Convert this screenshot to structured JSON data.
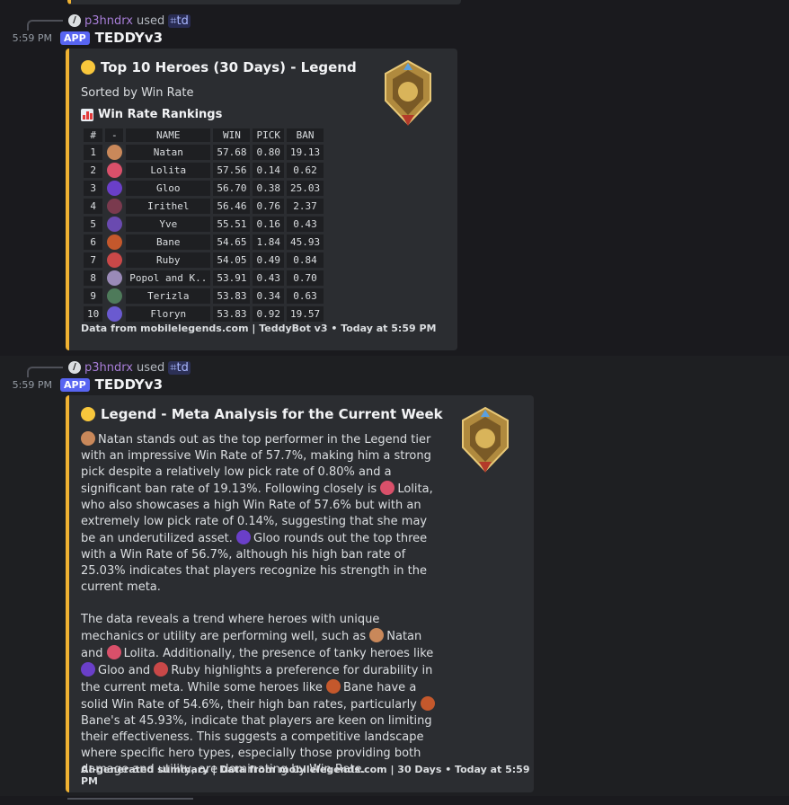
{
  "top_embed_edge": "",
  "messages": [
    {
      "reply": {
        "user": "p3hndrx",
        "used": "used",
        "command": "td"
      },
      "time": "5:59 PM",
      "badge": "APP",
      "bot": "TEDDYv3",
      "embed": {
        "title": "Top 10 Heroes (30 Days) - Legend",
        "subtitle": "Sorted by Win Rate",
        "section": "Win Rate Rankings",
        "table": {
          "headers": [
            "#",
            "-",
            "NAME",
            "WIN",
            "PICK",
            "BAN"
          ],
          "rows": [
            [
              "1",
              "Natan",
              "57.68",
              "0.80",
              "19.13"
            ],
            [
              "2",
              "Lolita",
              "57.56",
              "0.14",
              "0.62"
            ],
            [
              "3",
              "Gloo",
              "56.70",
              "0.38",
              "25.03"
            ],
            [
              "4",
              "Irithel",
              "56.46",
              "0.76",
              "2.37"
            ],
            [
              "5",
              "Yve",
              "55.51",
              "0.16",
              "0.43"
            ],
            [
              "6",
              "Bane",
              "54.65",
              "1.84",
              "45.93"
            ],
            [
              "7",
              "Ruby",
              "54.05",
              "0.49",
              "0.84"
            ],
            [
              "8",
              "Popol and K..",
              "53.91",
              "0.43",
              "0.70"
            ],
            [
              "9",
              "Terizla",
              "53.83",
              "0.34",
              "0.63"
            ],
            [
              "10",
              "Floryn",
              "53.83",
              "0.92",
              "19.57"
            ]
          ]
        },
        "footer": "Data from mobilelegends.com | TeddyBot v3 • Today at 5:59 PM"
      }
    },
    {
      "reply": {
        "user": "p3hndrx",
        "used": "used",
        "command": "td"
      },
      "time": "5:59 PM",
      "badge": "APP",
      "bot": "TEDDYv3",
      "embed": {
        "title": "Legend - Meta Analysis for the Current Week",
        "p1": [
          "Natan stands out as the top performer in the Legend tier with an impressive Win Rate of 57.7%, making him a strong pick despite a relatively low pick rate of 0.80% and a significant ban rate of 19.13%. Following closely is ",
          "Lolita, who also showcases a high Win Rate of 57.6% but with an extremely low pick rate of 0.14%, suggesting that she may be an underutilized asset. ",
          "Gloo rounds out the top three with a Win Rate of 56.7%, although his high ban rate of 25.03% indicates that players recognize his strength in the current meta."
        ],
        "p2": [
          "The data reveals a trend where heroes with unique mechanics or utility are performing well, such as ",
          "Natan and ",
          "Lolita. Additionally, the presence of tanky heroes like ",
          "Gloo and ",
          "Ruby highlights a preference for durability in the current meta. While some heroes like ",
          "Bane have a solid Win Rate of 54.6%, their high ban rates, particularly ",
          "Bane's at 45.93%, indicate that players are keen on limiting their effectiveness. This suggests a competitive landscape where specific hero types, especially those providing both damage and utility, are dominating by Win Rate."
        ],
        "footer": "AI-generated summary | Data from mobilelegends.com | 30 Days • Today at 5:59 PM"
      }
    }
  ],
  "hero_colors": {
    "Natan": "#c9885a",
    "Lolita": "#d9506a",
    "Gloo": "#6a3fc8",
    "Irithel": "#7a3a4e",
    "Yve": "#6a4ab0",
    "Bane": "#c4582c",
    "Ruby": "#c94848",
    "Popol": "#9a8ab8",
    "Terizla": "#4e7a5a",
    "Floryn": "#6a5ad0"
  },
  "accent": "#f0b232",
  "brand": "#5865f2"
}
